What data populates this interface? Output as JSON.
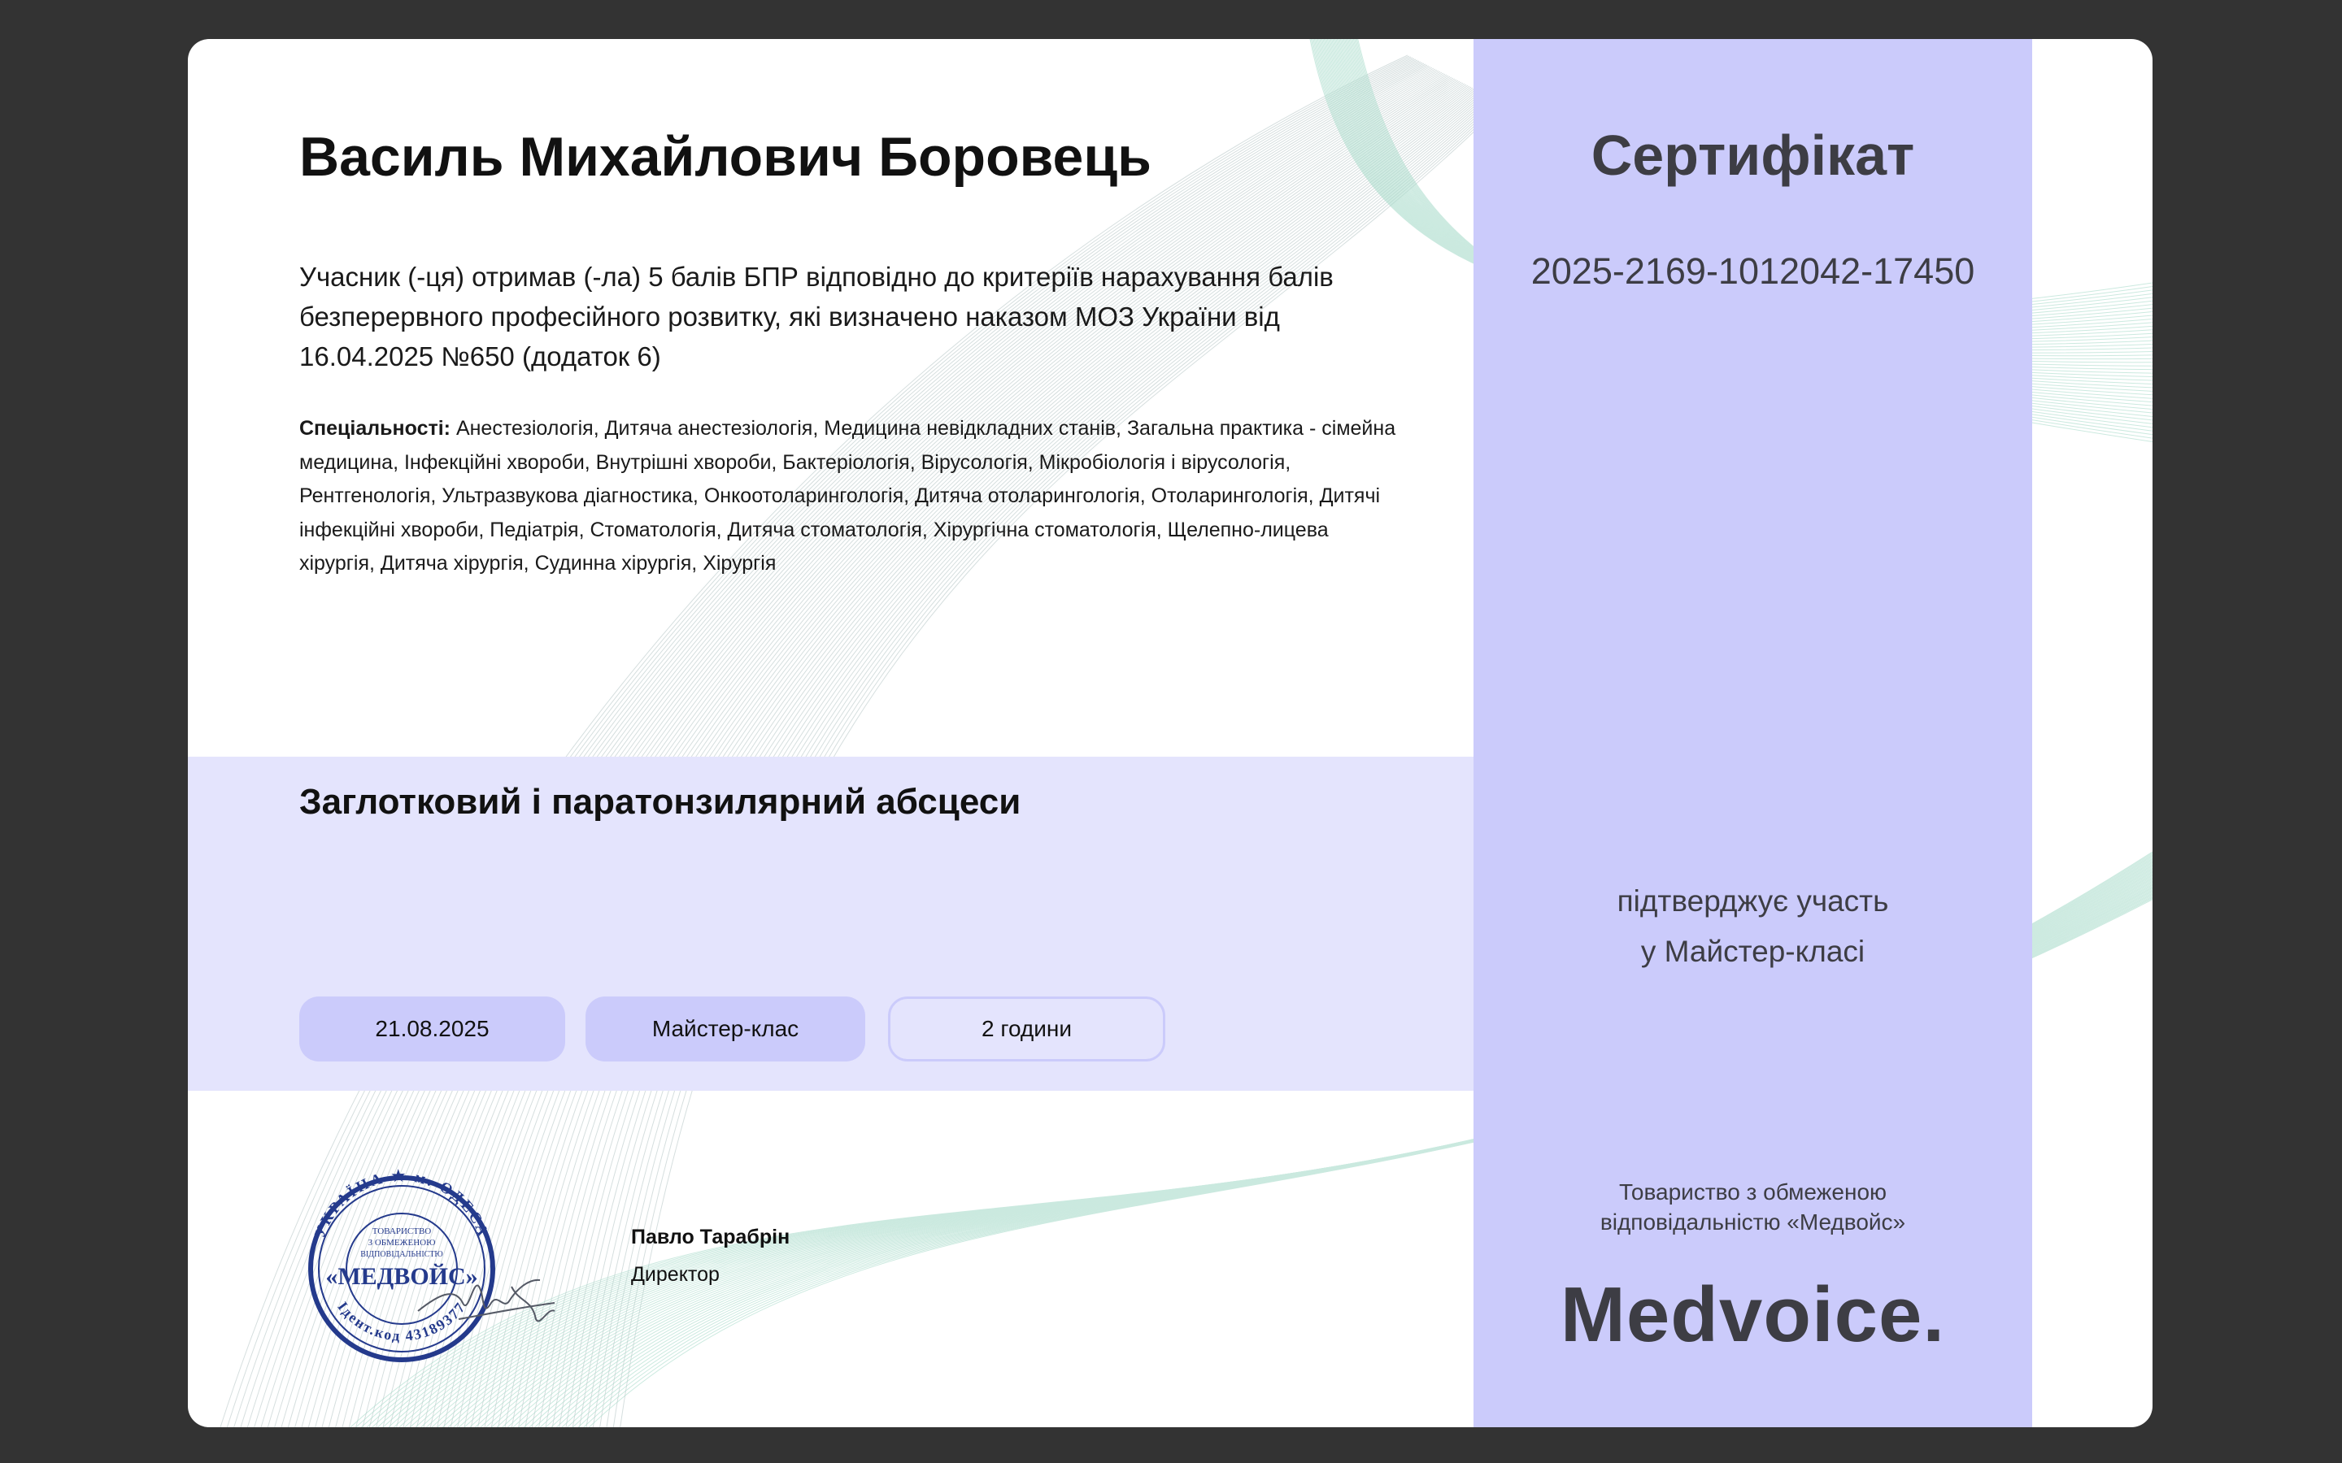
{
  "certificate": {
    "recipient_name": "Василь Михайлович Боровець",
    "description": "Учасник (-ця) отримав (-ла) 5 балів БПР відповідно до критеріїв нарахування балів безперервного професійного розвитку, які визначено наказом МОЗ України від 16.04.2025 №650 (додаток 6)",
    "specialties_label": "Спеціальності:",
    "specialties_text": " Анестезіологія, Дитяча анестезіологія, Медицина невідкладних станів, Загальна практика - сімейна медицина, Інфекційні хвороби, Внутрішні хвороби, Бактеріологія, Вірусологія, Мікробіологія і вірусологія, Рентгенологія, Ультразвукова діагностика, Онкоотоларингологія, Дитяча отоларингологія, Отоларингологія, Дитячі інфекційні хвороби, Педіатрія, Стоматологія, Дитяча стоматологія, Хірургічна стоматологія, Щелепно-лицева хірургія, Дитяча хірургія, Судинна хірургія, Хірургія",
    "course_title": "Заглотковий і паратонзилярний абсцеси",
    "chips": {
      "date": "21.08.2025",
      "format": "Майстер-клас",
      "duration": "2 години"
    },
    "signatory": {
      "name": "Павло Тарабрін",
      "role": "Директор"
    },
    "stamp": {
      "outer_top": "УКРАЇНА ★ м. ОДЕСА",
      "inner_line1": "ТОВАРИСТВО",
      "inner_line2": "З ОБМЕЖЕНОЮ",
      "inner_line3": "ВІДПОВІДАЛЬНІСТЮ",
      "center": "«МЕДВОЙС»",
      "outer_bottom": "Ідент.код 43189377"
    }
  },
  "sidebar": {
    "title": "Сертифікат",
    "number": "2025-2169-1012042-17450",
    "confirm_line1": "підтверджує участь",
    "confirm_line2": "у Майстер-класі",
    "org_line1": "Товариство з обмеженою",
    "org_line2": "відповідальністю «Медвойс»",
    "logo_text": "Medvoice."
  },
  "colors": {
    "background": "#333333",
    "paper": "#ffffff",
    "sidebar": "#cbcbfb",
    "band": "#e4e4fd",
    "stamp_blue": "#243a8c",
    "text_dark": "#3d3d44"
  }
}
